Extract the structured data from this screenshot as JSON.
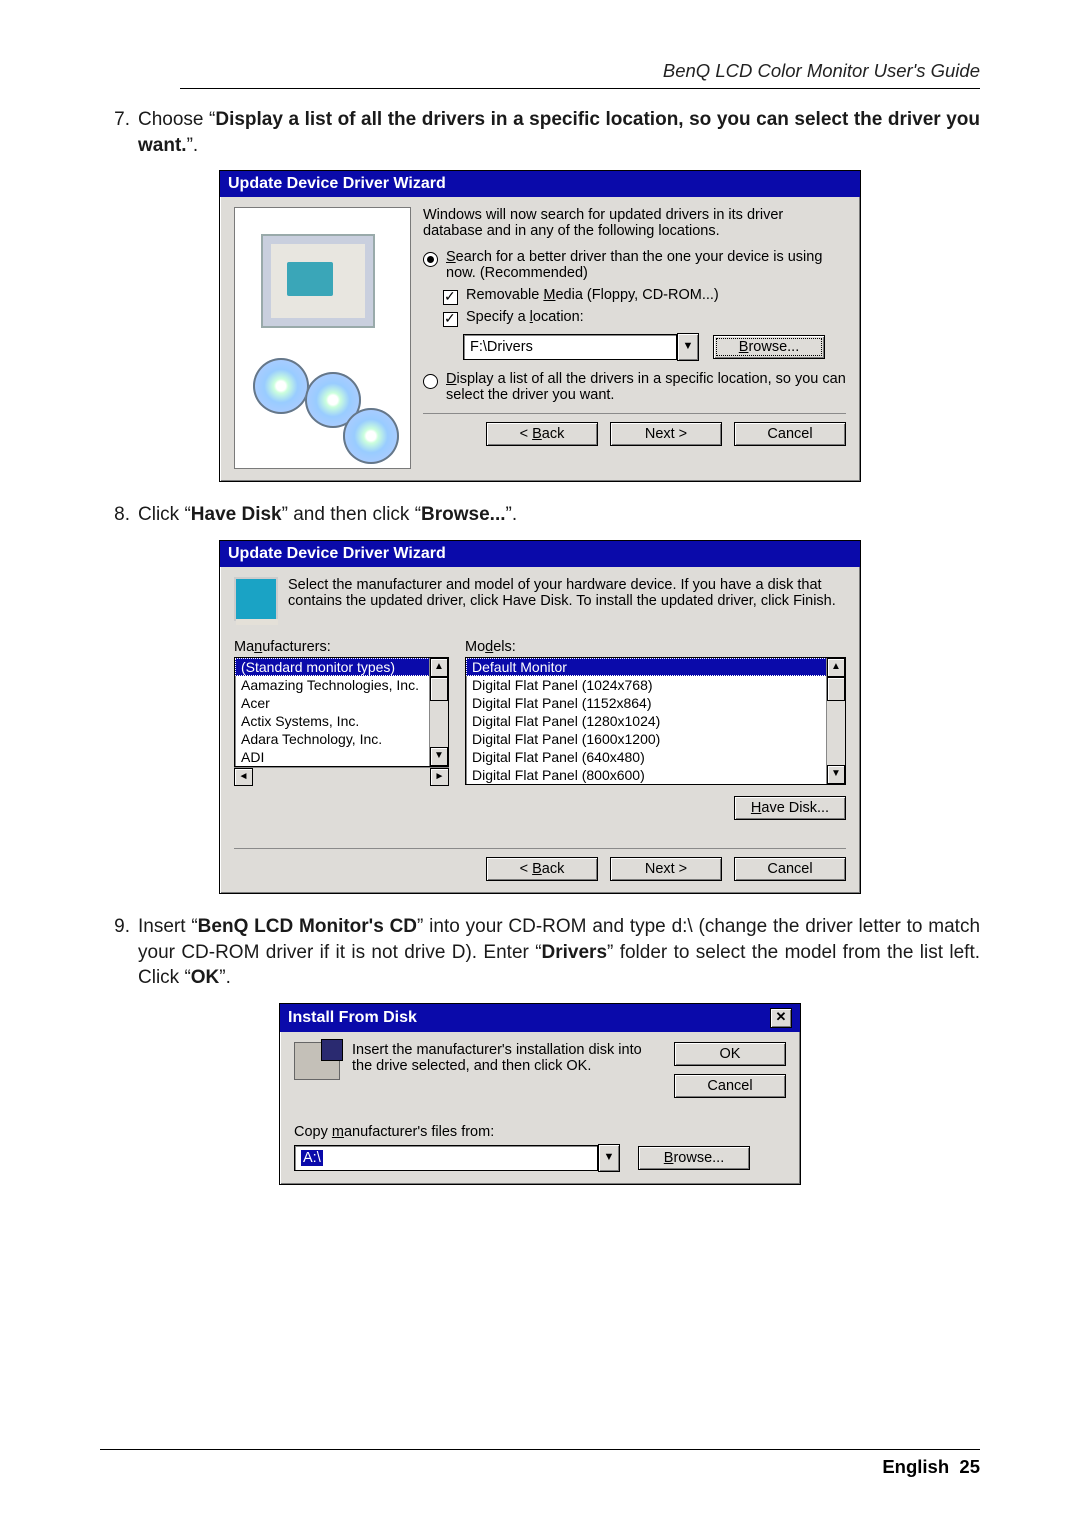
{
  "page": {
    "running_head": "BenQ LCD Color Monitor User's Guide",
    "footer_label": "English",
    "footer_page": "25"
  },
  "steps": {
    "s7": {
      "num": "7.",
      "pre": "Choose “",
      "bold": "Display a list of all the drivers in a specific location, so you can select the driver you want.",
      "post": "”."
    },
    "s8": {
      "num": "8.",
      "pre": "Click “",
      "bold1": "Have Disk",
      "mid": "” and then click “",
      "bold2": "Browse...",
      "post": "”."
    },
    "s9": {
      "num": "9.",
      "pre": "Insert “",
      "bold1": "BenQ LCD Monitor's CD",
      "mid1": "” into your CD-ROM and type d:\\ (change the driver letter to match your CD-ROM driver if it is not drive D). Enter “",
      "bold2": "Drivers",
      "mid2": "” folder to select the model from the list left. Click “",
      "bold3": "OK",
      "post": "”."
    }
  },
  "dlg1": {
    "title": "Update Device Driver Wizard",
    "intro": "Windows will now search for updated drivers in its driver database and in any of the following locations.",
    "opt_search": "Search for a better driver than the one your device is using now. (Recommended)",
    "chk_removable": "Removable Media (Floppy, CD-ROM...)",
    "chk_specify": "Specify a location:",
    "path": "F:\\Drivers",
    "browse": "Browse...",
    "opt_display": "Display a list of all the drivers in a specific location, so you can select the driver you want.",
    "back": "< Back",
    "next": "Next >",
    "cancel": "Cancel"
  },
  "dlg2": {
    "title": "Update Device Driver Wizard",
    "intro": "Select the manufacturer and model of your hardware device. If you have a disk that contains the updated driver, click Have Disk. To install the updated driver, click Finish.",
    "manu_label": "Manufacturers:",
    "models_label": "Models:",
    "manufacturers": [
      "(Standard monitor types)",
      "Aamazing Technologies, Inc.",
      "Acer",
      "Actix Systems, Inc.",
      "Adara Technology, Inc.",
      "ADI"
    ],
    "models": [
      "Default Monitor",
      "Digital Flat Panel (1024x768)",
      "Digital Flat Panel (1152x864)",
      "Digital Flat Panel (1280x1024)",
      "Digital Flat Panel (1600x1200)",
      "Digital Flat Panel (640x480)",
      "Digital Flat Panel (800x600)"
    ],
    "have_disk": "Have Disk...",
    "back": "< Back",
    "next": "Next >",
    "cancel": "Cancel"
  },
  "dlg3": {
    "title": "Install From Disk",
    "msg": "Insert the manufacturer's installation disk into the drive selected, and then click OK.",
    "ok": "OK",
    "cancel": "Cancel",
    "copy_label": "Copy manufacturer's files from:",
    "path": "A:\\",
    "browse": "Browse..."
  }
}
